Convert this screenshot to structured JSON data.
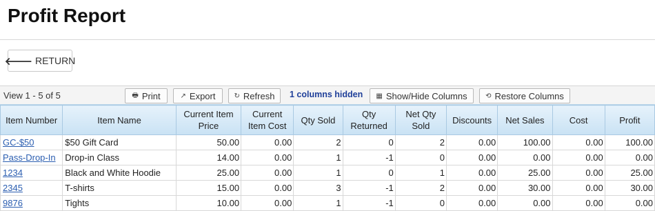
{
  "header": {
    "title": "Profit Report"
  },
  "return_button": {
    "arrow": "🡐",
    "label": "RETURN"
  },
  "toolbar": {
    "view_text": "View 1 - 5 of 5",
    "print_label": "Print",
    "export_label": "Export",
    "refresh_label": "Refresh",
    "hidden_columns_text": "1 columns hidden",
    "show_hide_label": "Show/Hide Columns",
    "restore_label": "Restore Columns",
    "icons": {
      "print": "printer-icon",
      "export": "external-link-icon",
      "refresh": "refresh-icon",
      "show_hide": "table-icon",
      "restore": "restore-icon"
    }
  },
  "table": {
    "headers": [
      "Item Number",
      "Item Name",
      "Current Item Price",
      "Current Item Cost",
      "Qty Sold",
      "Qty Returned",
      "Net Qty Sold",
      "Discounts",
      "Net Sales",
      "Cost",
      "Profit"
    ],
    "rows": [
      [
        "GC-$50",
        "$50 Gift Card",
        "50.00",
        "0.00",
        "2",
        "0",
        "2",
        "0.00",
        "100.00",
        "0.00",
        "100.00"
      ],
      [
        "Pass-Drop-In",
        "Drop-in Class",
        "14.00",
        "0.00",
        "1",
        "-1",
        "0",
        "0.00",
        "0.00",
        "0.00",
        "0.00"
      ],
      [
        "1234",
        "Black and White Hoodie",
        "25.00",
        "0.00",
        "1",
        "0",
        "1",
        "0.00",
        "25.00",
        "0.00",
        "25.00"
      ],
      [
        "2345",
        "T-shirts",
        "15.00",
        "0.00",
        "3",
        "-1",
        "2",
        "0.00",
        "30.00",
        "0.00",
        "30.00"
      ],
      [
        "9876",
        "Tights",
        "10.00",
        "0.00",
        "1",
        "-1",
        "0",
        "0.00",
        "0.00",
        "0.00",
        "0.00"
      ]
    ]
  },
  "colors": {
    "link": "#2a5db0",
    "header_bg": "#c9e2f4",
    "hidden_text": "#1f3f99"
  }
}
